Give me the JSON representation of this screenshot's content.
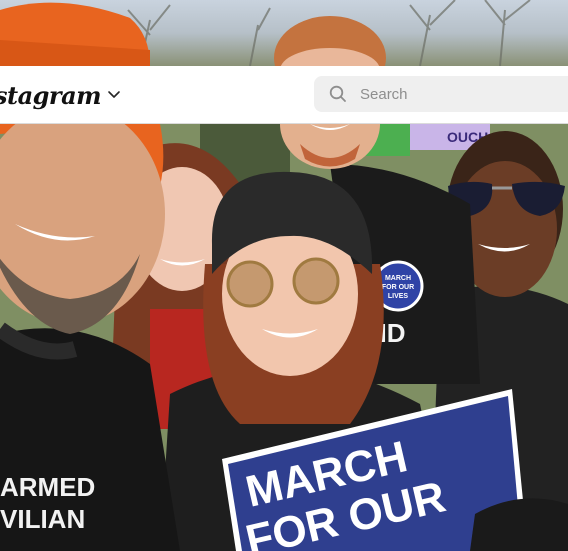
{
  "header": {
    "brand_text": "stagram",
    "search_placeholder": "Search"
  },
  "icons": {
    "brand_dropdown": "chevron-down-icon",
    "search": "magnifier-icon"
  },
  "photo": {
    "sign_line1": "MARCH",
    "sign_line2": "FOR OUR",
    "button_line1": "MARCH",
    "button_line2": "FOR OUR",
    "button_line3": "LIVES",
    "shirt_left_line1": "ARMED",
    "shirt_left_line2": "VILIAN",
    "shirt_right": "ND",
    "banner_text": "OUCH"
  },
  "colors": {
    "header_bg": "#ffffff",
    "search_bg": "#efefef",
    "placeholder": "#8e8e8e",
    "beanie_orange": "#e8641f",
    "sign_blue": "#2f3f8f"
  }
}
